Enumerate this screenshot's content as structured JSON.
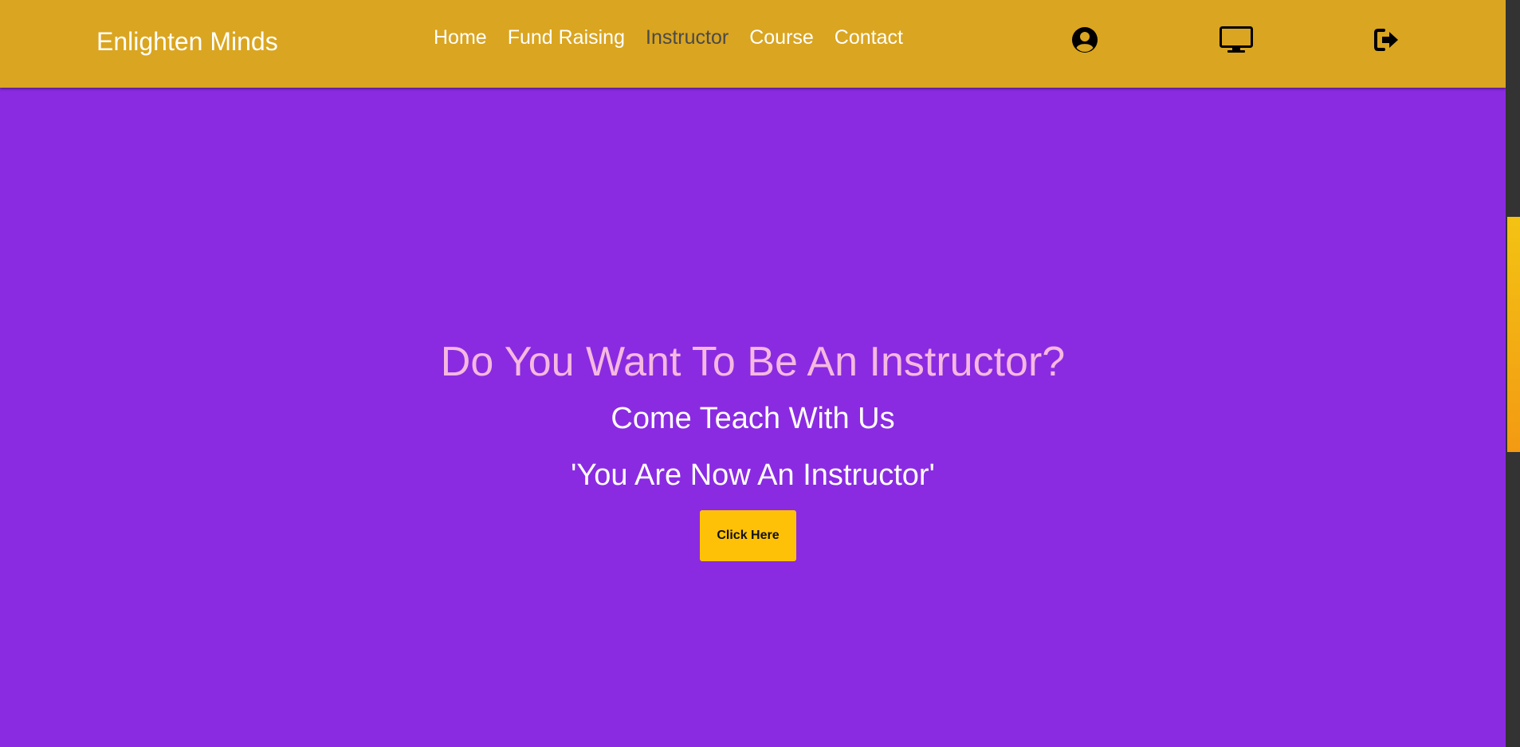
{
  "brand": {
    "name": "Enlighten Minds"
  },
  "nav": {
    "items": [
      {
        "label": "Home"
      },
      {
        "label": "Fund Raising"
      },
      {
        "label": "Instructor"
      },
      {
        "label": "Course"
      },
      {
        "label": "Contact"
      }
    ],
    "active": "Instructor",
    "icons": [
      "user-circle-icon",
      "desktop-monitor-icon",
      "sign-out-icon"
    ]
  },
  "hero": {
    "title": "Do You Want To Be An Instructor?",
    "subtitle": "Come Teach With Us",
    "message": "'You Are Now An Instructor'",
    "button_label": "Click Here"
  },
  "colors": {
    "navbar": "#daa520",
    "background": "#8a2be2",
    "title": "#f5b8e0",
    "button": "#ffc107",
    "active_link": "#4a4a4a"
  }
}
